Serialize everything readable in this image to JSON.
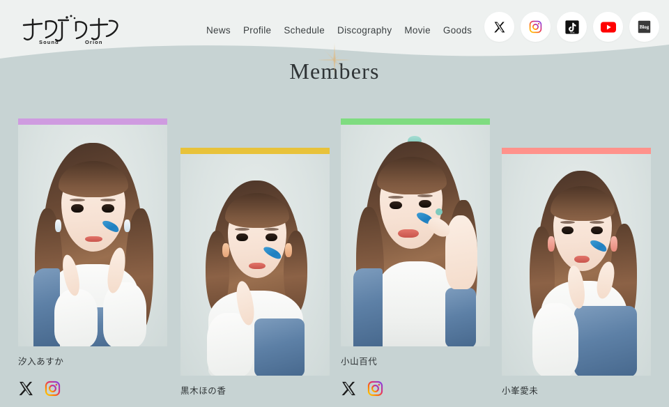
{
  "site": {
    "logo_main": "サンドリオン",
    "logo_sub_left": "Sound",
    "logo_sub_right": "Orion",
    "bg_color": "#c7d3d3",
    "header_bg_color": "#eef1f0"
  },
  "nav": {
    "items": [
      {
        "label": "News",
        "name": "news"
      },
      {
        "label": "Profile",
        "name": "profile"
      },
      {
        "label": "Schedule",
        "name": "schedule"
      },
      {
        "label": "Discography",
        "name": "discography"
      },
      {
        "label": "Movie",
        "name": "movie"
      },
      {
        "label": "Goods",
        "name": "goods"
      }
    ]
  },
  "social_links": [
    {
      "icon": "x-twitter-icon",
      "label": "X",
      "color": "#000000"
    },
    {
      "icon": "instagram-icon",
      "label": "Instagram",
      "color": "#e1306c"
    },
    {
      "icon": "tiktok-icon",
      "label": "TikTok",
      "color": "#000000"
    },
    {
      "icon": "youtube-icon",
      "label": "YouTube",
      "color": "#ff0000"
    },
    {
      "icon": "blog-icon",
      "label": "Blog",
      "color": "#2f2f2f"
    }
  ],
  "page": {
    "title": "Members",
    "decoration": "sparkle-icon"
  },
  "members": [
    {
      "name": "汐入あすか",
      "accent_color": "#cf9be0",
      "socials": [
        {
          "icon": "x-twitter-icon",
          "label": "X"
        },
        {
          "icon": "instagram-icon",
          "label": "Instagram"
        }
      ]
    },
    {
      "name": "黒木ほの香",
      "accent_color": "#e8c23a",
      "socials": []
    },
    {
      "name": "小山百代",
      "accent_color": "#7fdc80",
      "socials": [
        {
          "icon": "x-twitter-icon",
          "label": "X"
        },
        {
          "icon": "instagram-icon",
          "label": "Instagram"
        }
      ]
    },
    {
      "name": "小峯愛未",
      "accent_color": "#ff928b",
      "socials": []
    }
  ]
}
